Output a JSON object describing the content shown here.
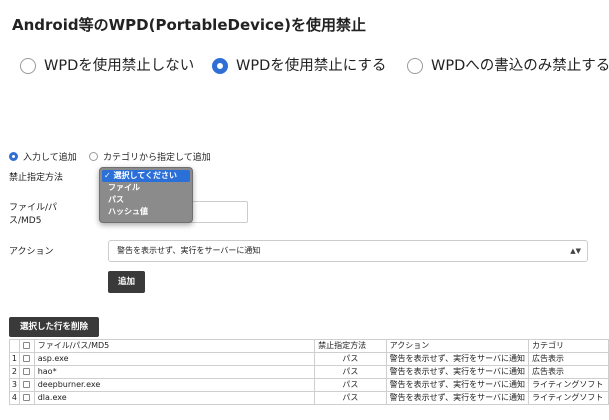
{
  "page": {
    "title": "Android等のWPD(PortableDevice)を使用禁止"
  },
  "wpd_options": [
    {
      "label": "WPDを使用禁止しない",
      "selected": false
    },
    {
      "label": "WPDを使用禁止にする",
      "selected": true
    },
    {
      "label": "WPDへの書込のみ禁止する",
      "selected": false
    }
  ],
  "add_mode": [
    {
      "label": "入力して追加",
      "selected": true
    },
    {
      "label": "カテゴリから指定して追加",
      "selected": false
    }
  ],
  "form": {
    "method_label": "禁止指定方法",
    "path_label_1": "ファイル/パ",
    "path_label_2": "ス/MD5",
    "action_label": "アクション",
    "action_value": "警告を表示せず、実行をサーバーに通知",
    "add_button": "追加"
  },
  "method_dropdown": {
    "options": [
      {
        "label": "✓ 選択してください",
        "selected": true
      },
      {
        "label": "ファイル",
        "selected": false
      },
      {
        "label": "パス",
        "selected": false
      },
      {
        "label": "ハッシュ値",
        "selected": false
      }
    ]
  },
  "delete_button": "選択した行を削除",
  "table": {
    "headers": [
      "",
      "",
      "ファイル/パス/MD5",
      "禁止指定方法",
      "アクション",
      "カテゴリ"
    ],
    "rows": [
      [
        "1",
        "asp.exe",
        "パス",
        "警告を表示せず、実行をサーバに通知",
        "広告表示"
      ],
      [
        "2",
        "hao*",
        "パス",
        "警告を表示せず、実行をサーバに通知",
        "広告表示"
      ],
      [
        "3",
        "deepburner.exe",
        "パス",
        "警告を表示せず、実行をサーバに通知",
        "ライティングソフト"
      ],
      [
        "4",
        "dla.exe",
        "パス",
        "警告を表示せず、実行をサーバに通知",
        "ライティングソフト"
      ]
    ]
  },
  "colors": {
    "accent": "#2f6fd6",
    "dark_button": "#3a3a3a",
    "dropdown_bg": "#8b8b8b",
    "dropdown_selected": "#2b6fd9"
  }
}
